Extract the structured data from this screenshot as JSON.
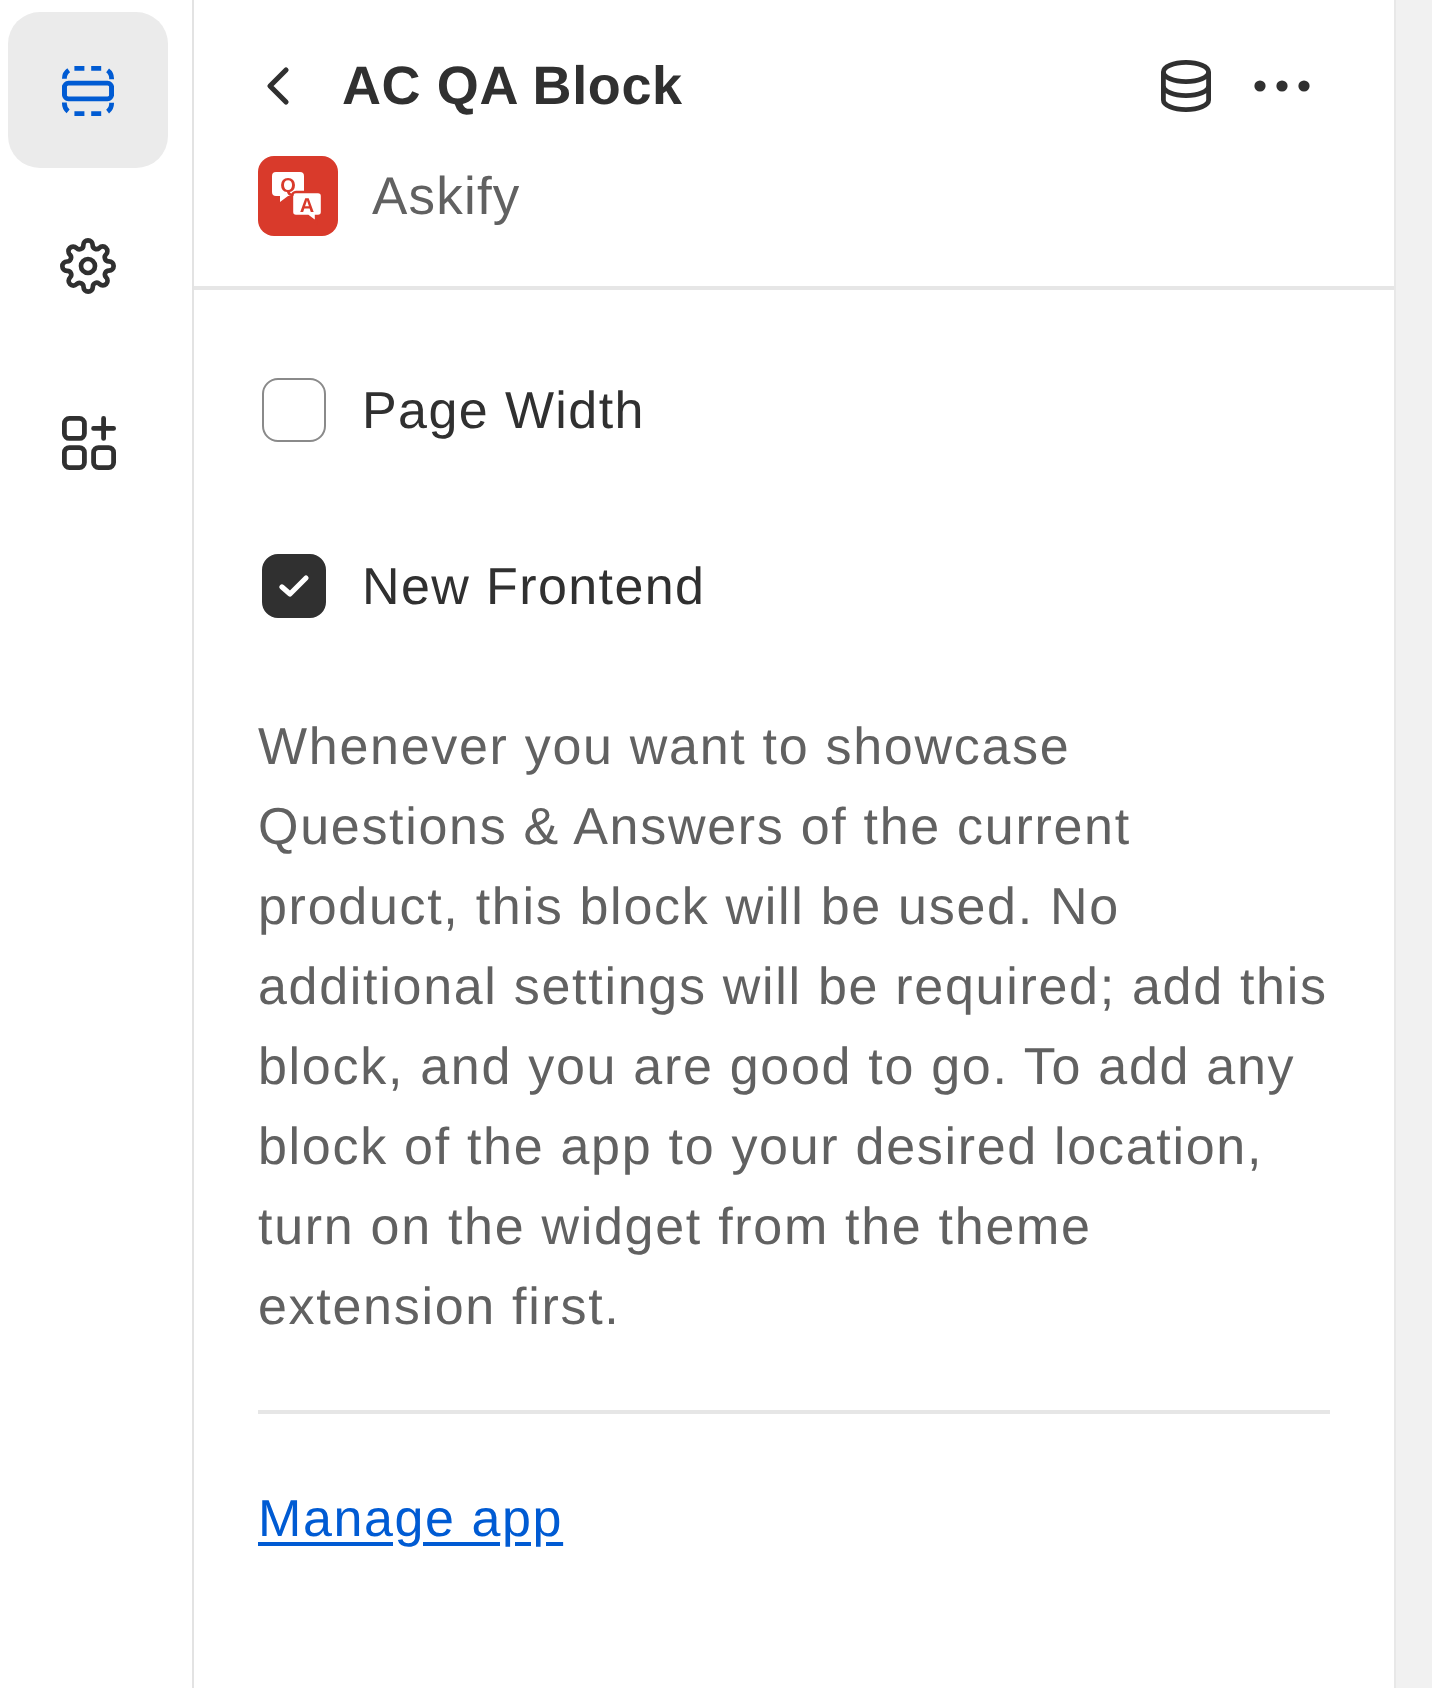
{
  "sidebar": {
    "items": [
      {
        "kind": "sections",
        "selected": true
      },
      {
        "kind": "settings",
        "selected": false
      },
      {
        "kind": "apps",
        "selected": false
      }
    ]
  },
  "header": {
    "title": "AC QA Block",
    "app_name": "Askify",
    "app_logo_letters": [
      "Q",
      "A"
    ]
  },
  "settings": [
    {
      "label": "Page Width",
      "checked": false
    },
    {
      "label": "New Frontend",
      "checked": true
    }
  ],
  "description": "Whenever you want to showcase Questions & Answers of the current product, this block will be used. No additional settings will be required; add this block, and you are good to go. To add any block of the app to your desired location, turn on the widget from the theme extension first.",
  "link": "Manage app"
}
